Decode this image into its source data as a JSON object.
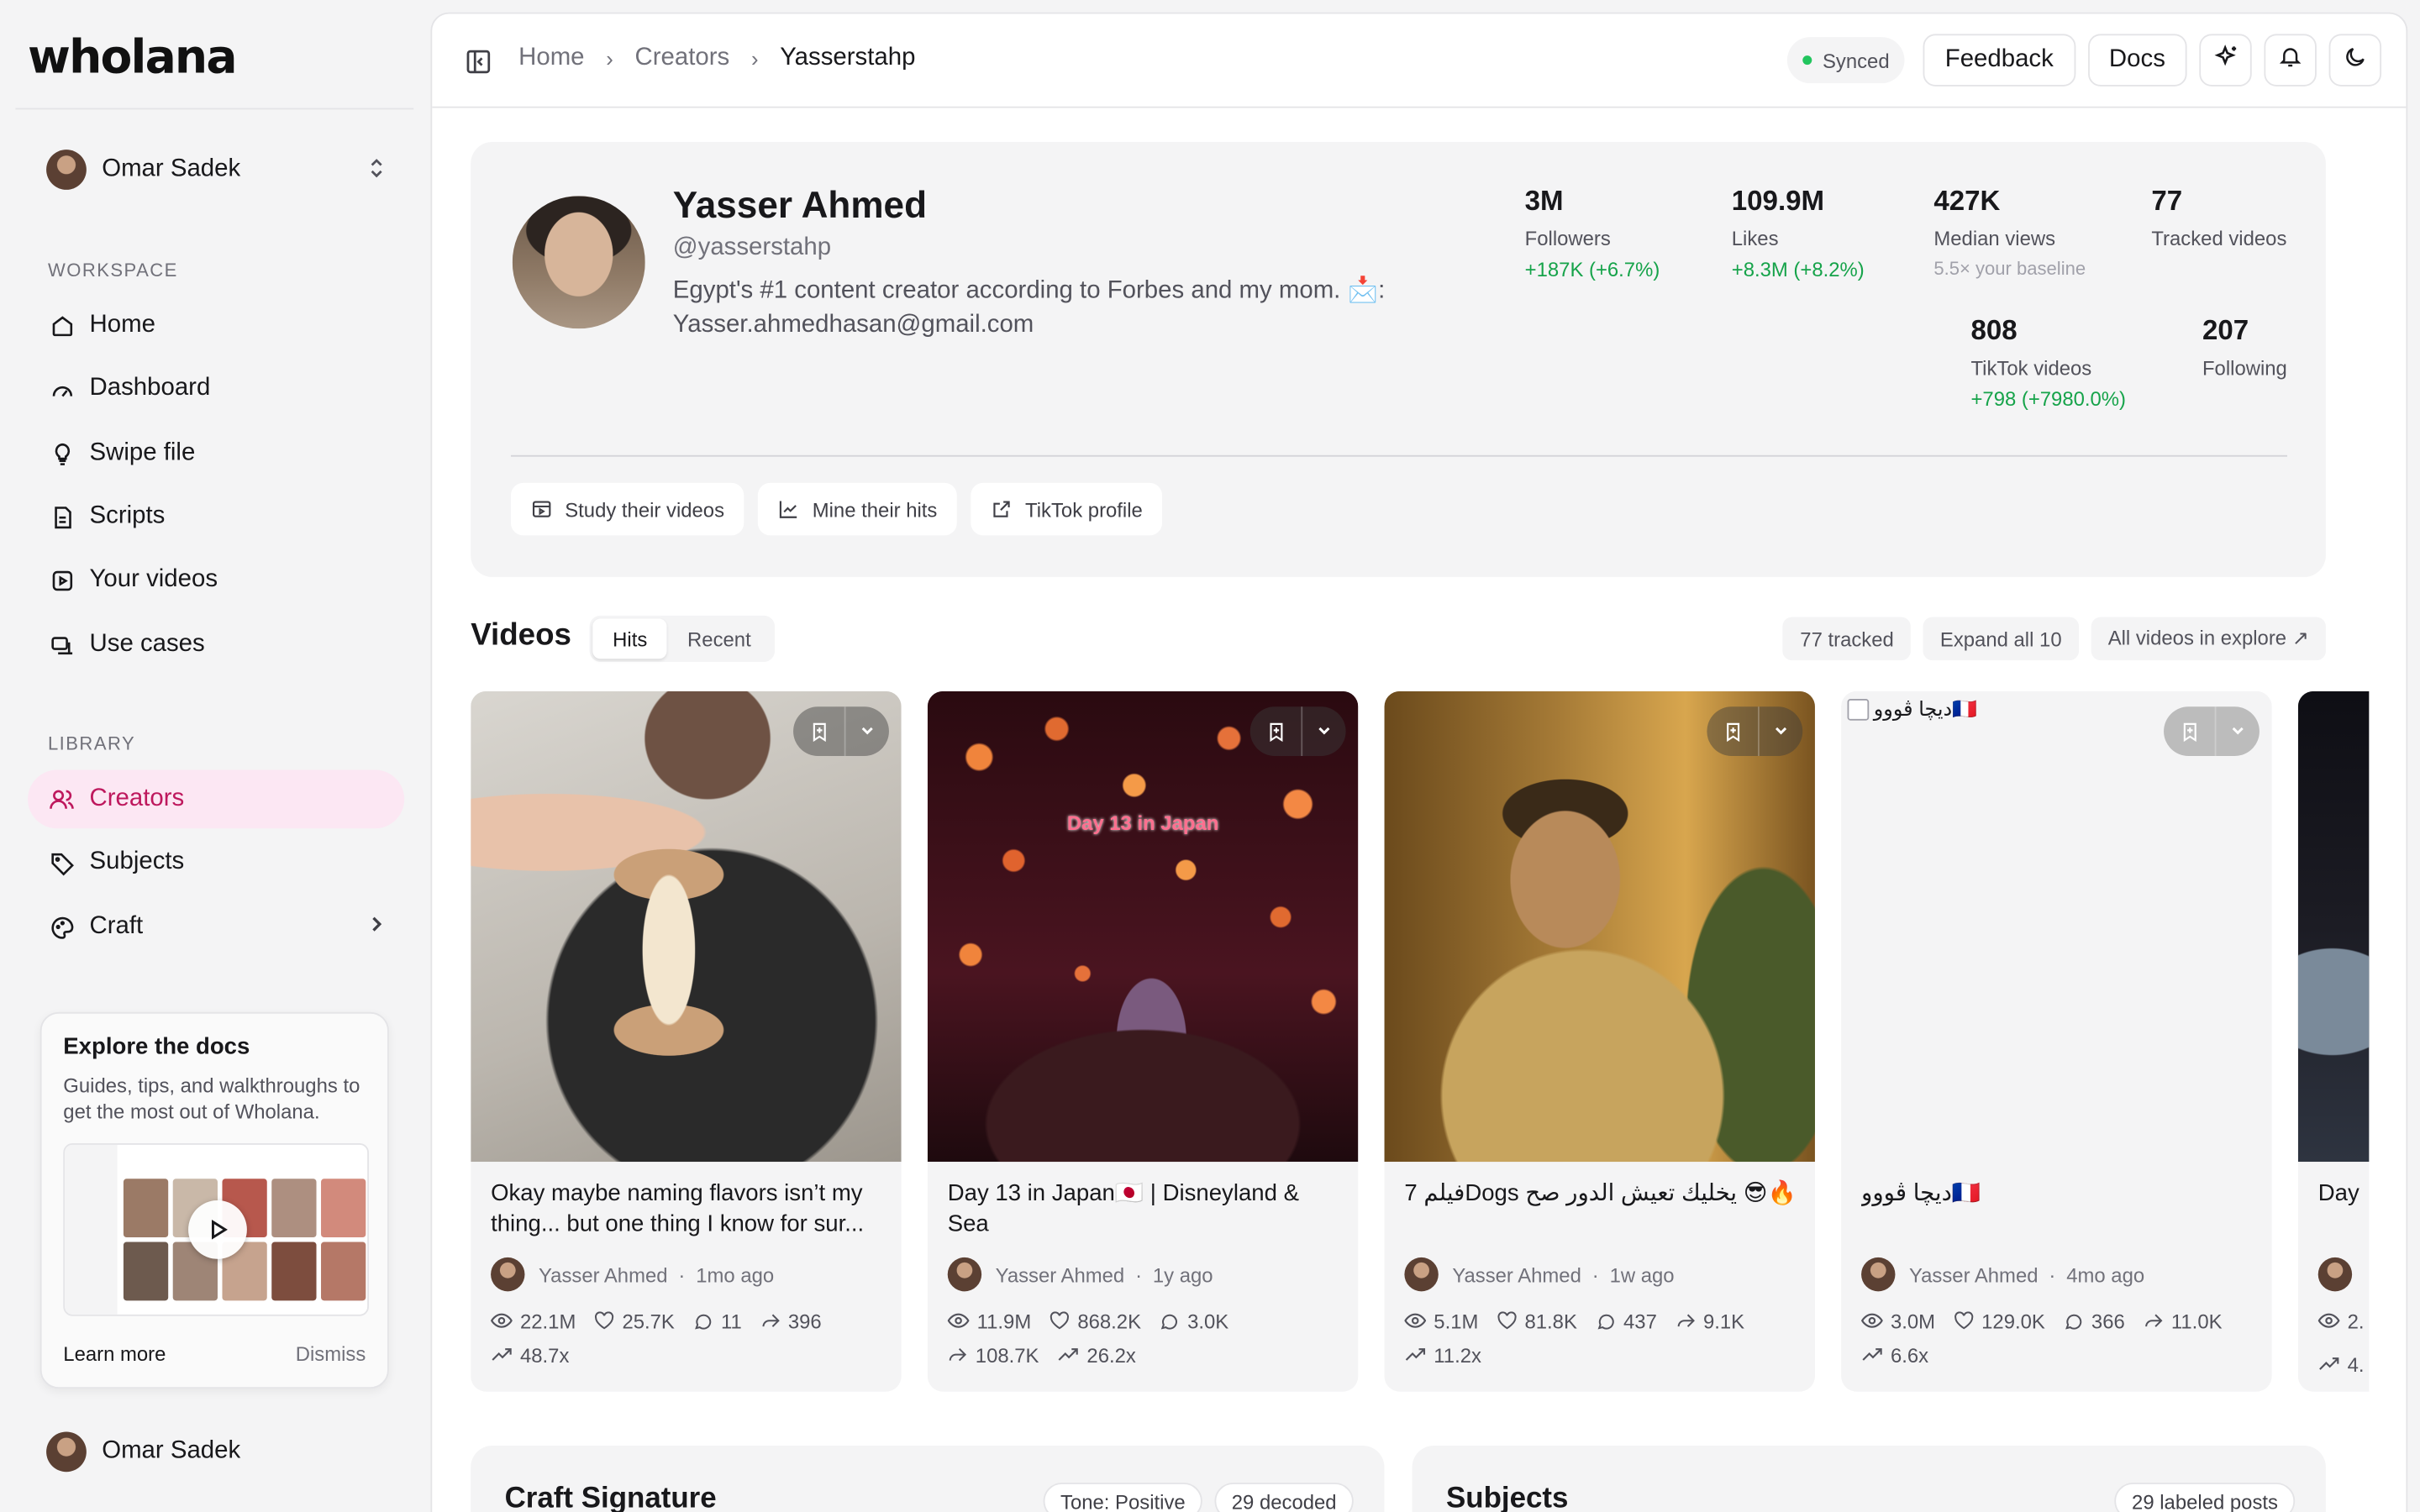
{
  "app": {
    "logo": "wholana",
    "account_name": "Omar Sadek",
    "footer_account_name": "Omar Sadek"
  },
  "sidebar": {
    "workspace_label": "WORKSPACE",
    "workspace_items": [
      {
        "label": "Home",
        "icon": "home-icon"
      },
      {
        "label": "Dashboard",
        "icon": "gauge-icon"
      },
      {
        "label": "Swipe file",
        "icon": "lightbulb-icon"
      },
      {
        "label": "Scripts",
        "icon": "script-icon"
      },
      {
        "label": "Your videos",
        "icon": "video-icon"
      },
      {
        "label": "Use cases",
        "icon": "use-cases-icon"
      }
    ],
    "library_label": "LIBRARY",
    "library_items": [
      {
        "label": "Creators",
        "icon": "users-icon",
        "active": true
      },
      {
        "label": "Subjects",
        "icon": "tag-icon"
      },
      {
        "label": "Craft",
        "icon": "palette-icon"
      }
    ]
  },
  "docs_card": {
    "title": "Explore the docs",
    "description": "Guides, tips, and walkthroughs to get the most out of Wholana.",
    "learn_more": "Learn more",
    "dismiss": "Dismiss"
  },
  "header": {
    "breadcrumbs": [
      "Home",
      "Creators",
      "Yasserstahp"
    ],
    "synced": "Synced",
    "feedback": "Feedback",
    "docs": "Docs"
  },
  "profile": {
    "name": "Yasser Ahmed",
    "handle": "@yasserstahp",
    "bio": "Egypt's #1 content creator according to Forbes and my mom. 📩: Yasser.ahmedhasan@gmail.com",
    "stats": {
      "followers": {
        "value": "3M",
        "label": "Followers",
        "delta": "+187K (+6.7%)"
      },
      "likes": {
        "value": "109.9M",
        "label": "Likes",
        "delta": "+8.3M (+8.2%)"
      },
      "median_views": {
        "value": "427K",
        "label": "Median views",
        "sub": "5.5× your baseline"
      },
      "tracked_videos": {
        "value": "77",
        "label": "Tracked videos"
      },
      "tiktok_videos": {
        "value": "808",
        "label": "TikTok videos",
        "delta": "+798 (+7980.0%)"
      },
      "following": {
        "value": "207",
        "label": "Following"
      }
    },
    "actions": [
      "Study their videos",
      "Mine their hits",
      "TikTok profile"
    ]
  },
  "videos": {
    "title": "Videos",
    "tabs": [
      "Hits",
      "Recent"
    ],
    "active_tab": "Hits",
    "tracked": "77 tracked",
    "expand": "Expand all 10",
    "explore": "All videos in explore ↗",
    "cards": [
      {
        "title": "Okay maybe naming flavors isn’t my thing... but one thing I know for sur...",
        "author": "Yasser Ahmed",
        "age": "1mo ago",
        "views": "22.1M",
        "likes": "25.7K",
        "comments": "11",
        "shares": "396",
        "multiplier": "48.7x"
      },
      {
        "title": "Day 13 in Japan🇯🇵 | Disneyland & Sea",
        "overlay_text": "Day 13 in Japan",
        "author": "Yasser Ahmed",
        "age": "1y ago",
        "views": "11.9M",
        "likes": "868.2K",
        "comments": "3.0K",
        "shares": "108.7K",
        "multiplier": "26.2x"
      },
      {
        "title": "7 فيلمDogs يخليك تعيش الدور صح 😎🔥",
        "author": "Yasser Ahmed",
        "age": "1w ago",
        "views": "5.1M",
        "likes": "81.8K",
        "comments": "437",
        "shares": "9.1K",
        "multiplier": "11.2x"
      },
      {
        "title": "ديچا ڤووو🇫🇷",
        "broken_alt": "ديچا ڤووو🇫🇷",
        "author": "Yasser Ahmed",
        "age": "4mo ago",
        "views": "3.0M",
        "likes": "129.0K",
        "comments": "366",
        "shares": "11.0K",
        "multiplier": "6.6x"
      },
      {
        "title": "Day",
        "views": "2.",
        "multiplier": "4."
      }
    ]
  },
  "panels": {
    "craft": {
      "title": "Craft Signature",
      "tags": [
        "Tone: Positive",
        "29 decoded"
      ]
    },
    "subjects": {
      "title": "Subjects",
      "tags": [
        "29 labeled posts"
      ]
    }
  },
  "colors": {
    "accent": "#be185d",
    "accent_bg": "#fce7f3",
    "positive": "#16a34a",
    "synced_dot": "#22c55e"
  }
}
